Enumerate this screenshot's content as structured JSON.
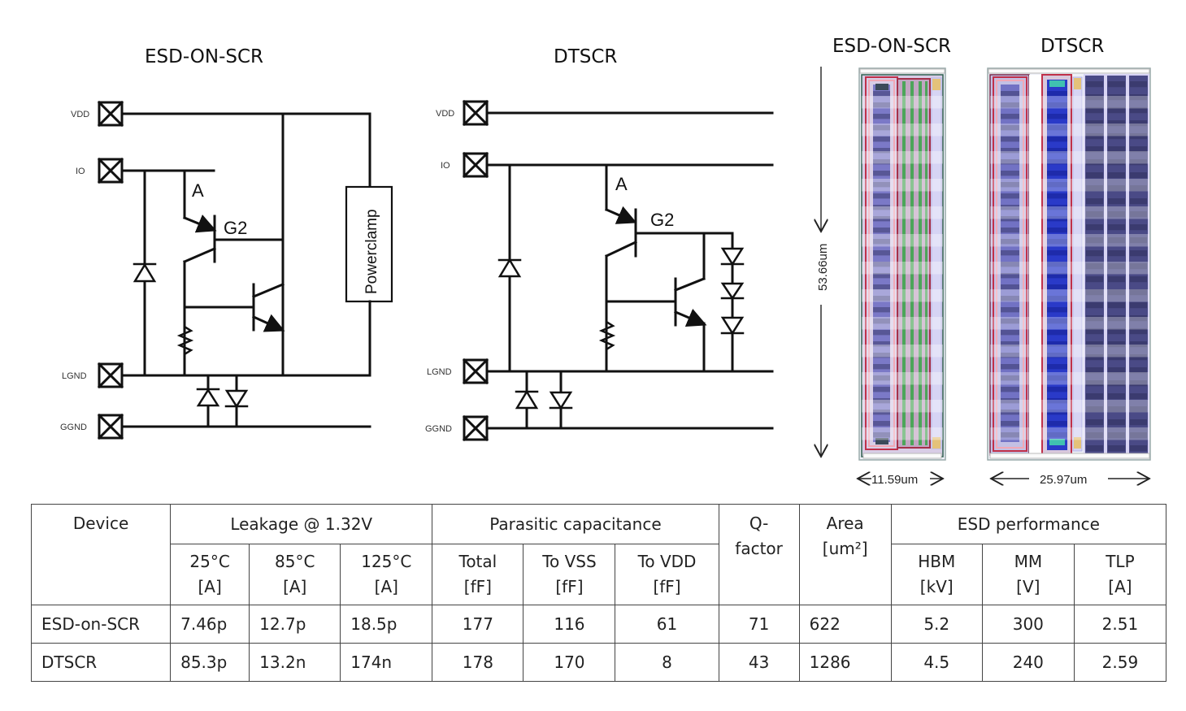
{
  "figure": {
    "schematics": [
      {
        "id": "esd-on-scr",
        "title": "ESD-ON-SCR",
        "pins": [
          "VDD",
          "IO",
          "LGND",
          "GGND"
        ],
        "labels": {
          "node_a": "A",
          "node_g2": "G2",
          "clamp": "Powerclamp"
        }
      },
      {
        "id": "dtscr",
        "title": "DTSCR",
        "pins": [
          "VDD",
          "IO",
          "LGND",
          "GGND"
        ],
        "labels": {
          "node_a": "A",
          "node_g2": "G2"
        }
      }
    ],
    "layouts": [
      {
        "id": "esd-on-scr",
        "title": "ESD-ON-SCR",
        "width_label": "11.59um"
      },
      {
        "id": "dtscr",
        "title": "DTSCR",
        "width_label": "25.97um"
      }
    ],
    "height_label": "53.66um"
  },
  "table": {
    "header_top": {
      "device": "Device",
      "leakage": "Leakage @ 1.32V",
      "capacitance": "Parasitic capacitance",
      "q_factor": "Q-\nfactor",
      "area": "Area\n[um²]",
      "esd": "ESD performance"
    },
    "header_sub": [
      {
        "line1": "25°C",
        "line2": "[A]"
      },
      {
        "line1": "85°C",
        "line2": "[A]"
      },
      {
        "line1": "125°C",
        "line2": "[A]"
      },
      {
        "line1": "Total",
        "line2": "[fF]"
      },
      {
        "line1": "To VSS",
        "line2": "[fF]"
      },
      {
        "line1": "To VDD",
        "line2": "[fF]"
      },
      {
        "line1": "HBM",
        "line2": "[kV]"
      },
      {
        "line1": "MM",
        "line2": "[V]"
      },
      {
        "line1": "TLP",
        "line2": "[A]"
      }
    ],
    "q_line1": "Q-",
    "q_line2": "factor",
    "area_line1": "Area",
    "area_line2": "[um²]",
    "rows": [
      {
        "device": "ESD-on-SCR",
        "leak_25": "7.46p",
        "leak_85": "12.7p",
        "leak_125": "18.5p",
        "cap_total": "177",
        "cap_vss": "116",
        "cap_vdd": "61",
        "q": "71",
        "area": "622",
        "hbm": "5.2",
        "mm": "300",
        "tlp": "2.51"
      },
      {
        "device": "DTSCR",
        "leak_25": "85.3p",
        "leak_85": "13.2n",
        "leak_125": "174n",
        "cap_total": "178",
        "cap_vss": "170",
        "cap_vdd": "8",
        "q": "43",
        "area": "1286",
        "hbm": "4.5",
        "mm": "240",
        "tlp": "2.59"
      }
    ]
  }
}
